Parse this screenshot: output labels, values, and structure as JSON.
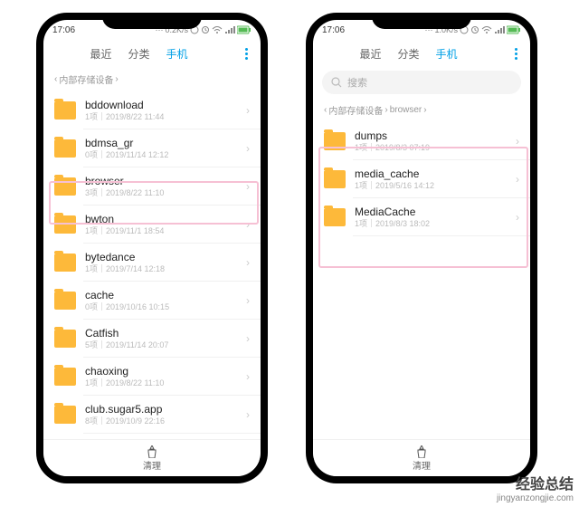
{
  "status": {
    "time": "17:06",
    "net_left": "0.2K/s",
    "net_right": "1.0K/s"
  },
  "tabs": {
    "recent": "最近",
    "category": "分类",
    "phone": "手机"
  },
  "search": {
    "placeholder": "搜索"
  },
  "crumb_left": {
    "root": "内部存储设备"
  },
  "crumb_right": {
    "root": "内部存储设备",
    "sub": "browser"
  },
  "folders_left": [
    {
      "name": "bddownload",
      "sub": "1项｜2019/8/22 11:44"
    },
    {
      "name": "bdmsa_gr",
      "sub": "0项｜2019/11/14 12:12"
    },
    {
      "name": "browser",
      "sub": "3项｜2019/8/22 11:10"
    },
    {
      "name": "bwton",
      "sub": "1项｜2019/11/1 18:54"
    },
    {
      "name": "bytedance",
      "sub": "1项｜2019/7/14 12:18"
    },
    {
      "name": "cache",
      "sub": "0项｜2019/10/16 10:15"
    },
    {
      "name": "Catfish",
      "sub": "5项｜2019/11/14 20:07"
    },
    {
      "name": "chaoxing",
      "sub": "1项｜2019/8/22 11:10"
    },
    {
      "name": "club.sugar5.app",
      "sub": "8项｜2019/10/9 22:16"
    }
  ],
  "folders_right": [
    {
      "name": "dumps",
      "sub": "1项｜2019/8/3 07:19"
    },
    {
      "name": "media_cache",
      "sub": "1项｜2019/5/16 14:12"
    },
    {
      "name": "MediaCache",
      "sub": "1项｜2019/8/3 18:02"
    }
  ],
  "bottom": {
    "label": "清理"
  },
  "watermark": {
    "title": "经验总结",
    "sub": "jingyanzongjie.com"
  }
}
